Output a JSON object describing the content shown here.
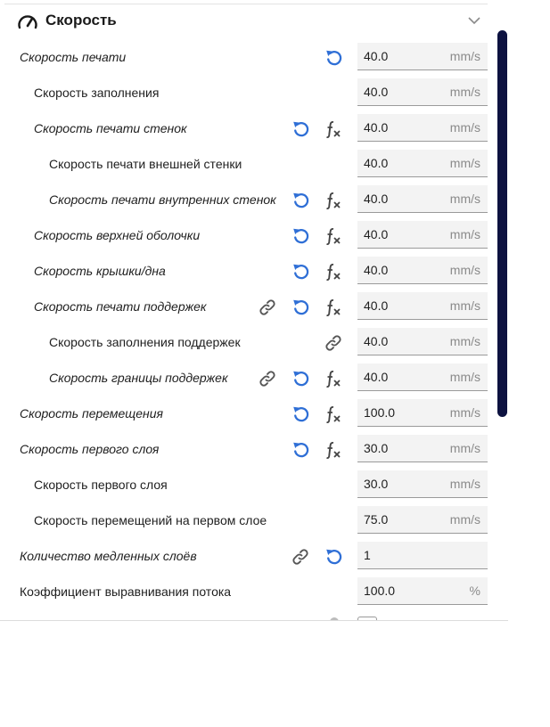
{
  "section": {
    "title": "Скорость"
  },
  "settings": [
    {
      "label": "Скорость печати",
      "value": "40.0",
      "unit": "mm/s"
    },
    {
      "label": "Скорость заполнения",
      "value": "40.0",
      "unit": "mm/s"
    },
    {
      "label": "Скорость печати стенок",
      "value": "40.0",
      "unit": "mm/s"
    },
    {
      "label": "Скорость печати внешней стенки",
      "value": "40.0",
      "unit": "mm/s"
    },
    {
      "label": "Скорость печати внутренних стенок",
      "value": "40.0",
      "unit": "mm/s"
    },
    {
      "label": "Скорость верхней оболочки",
      "value": "40.0",
      "unit": "mm/s"
    },
    {
      "label": "Скорость крышки/дна",
      "value": "40.0",
      "unit": "mm/s"
    },
    {
      "label": "Скорость печати поддержек",
      "value": "40.0",
      "unit": "mm/s"
    },
    {
      "label": "Скорость заполнения поддержек",
      "value": "40.0",
      "unit": "mm/s"
    },
    {
      "label": "Скорость границы поддержек",
      "value": "40.0",
      "unit": "mm/s"
    },
    {
      "label": "Скорость перемещения",
      "value": "100.0",
      "unit": "mm/s"
    },
    {
      "label": "Скорость первого слоя",
      "value": "30.0",
      "unit": "mm/s"
    },
    {
      "label": "Скорость первого слоя",
      "value": "30.0",
      "unit": "mm/s"
    },
    {
      "label": "Скорость перемещений на первом слое",
      "value": "75.0",
      "unit": "mm/s"
    },
    {
      "label": "Количество медленных слоёв",
      "value": "1",
      "unit": ""
    },
    {
      "label": "Коэффициент выравнивания потока",
      "value": "100.0",
      "unit": "%"
    }
  ],
  "colors": {
    "reset_icon": "#2f6fd6",
    "scrollbar": "#0d1240",
    "field_bg": "#f3f3f3"
  },
  "icons": {
    "header": "gauge-icon",
    "collapse": "chevron-down-icon",
    "reset": "reset-icon",
    "formula": "fx-icon",
    "linked": "link-icon"
  }
}
